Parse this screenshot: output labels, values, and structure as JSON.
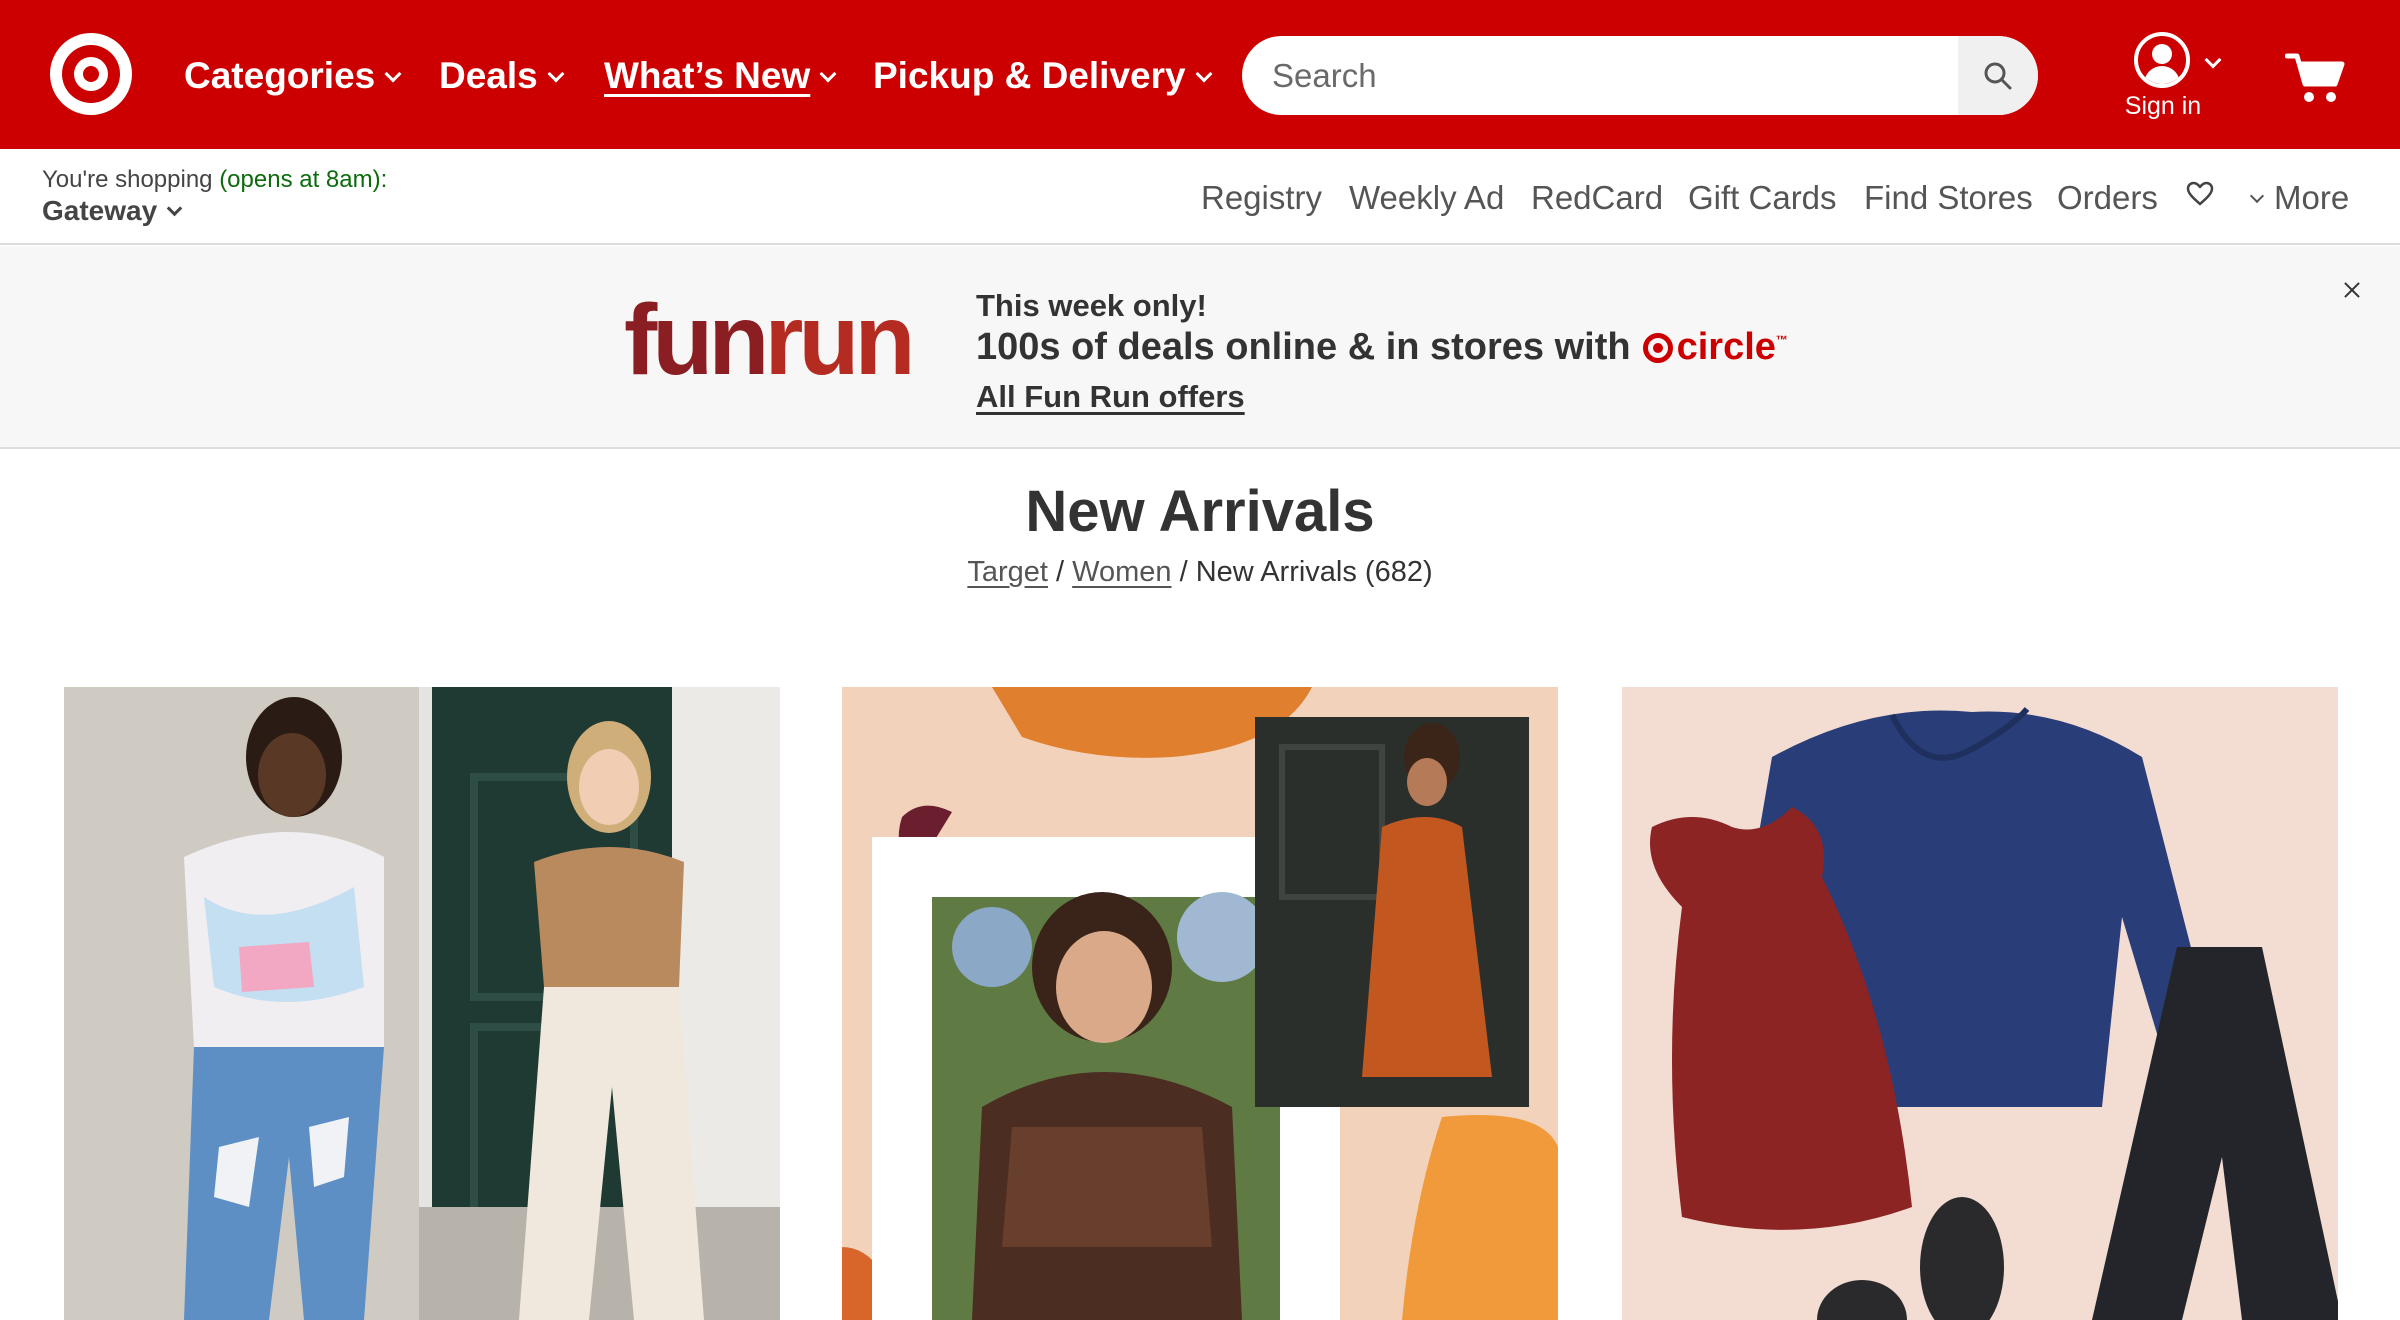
{
  "header": {
    "nav": [
      {
        "label": "Categories"
      },
      {
        "label": "Deals"
      },
      {
        "label": "What’s New"
      },
      {
        "label": "Pickup & Delivery"
      }
    ],
    "search_placeholder": "Search",
    "signin_label": "Sign in",
    "brand_color": "#cc0000"
  },
  "subbar": {
    "shopping_prefix": "You're shopping",
    "shopping_status": "(opens at 8am):",
    "store_name": "Gateway",
    "links": [
      "Registry",
      "Weekly Ad",
      "RedCard",
      "Gift Cards",
      "Find Stores",
      "Orders"
    ],
    "more_label": "More"
  },
  "banner": {
    "logo_part1": "fun",
    "logo_part2": "run",
    "kicker": "This week only!",
    "headline": "100s of deals online & in stores with",
    "circle_label": "circle",
    "circle_tm": "™",
    "link": "All Fun Run offers"
  },
  "page": {
    "title": "New Arrivals",
    "breadcrumb": {
      "home": "Target",
      "sep1": "/",
      "section": "Women",
      "sep2": "/",
      "current": "New Arrivals (682)"
    }
  }
}
